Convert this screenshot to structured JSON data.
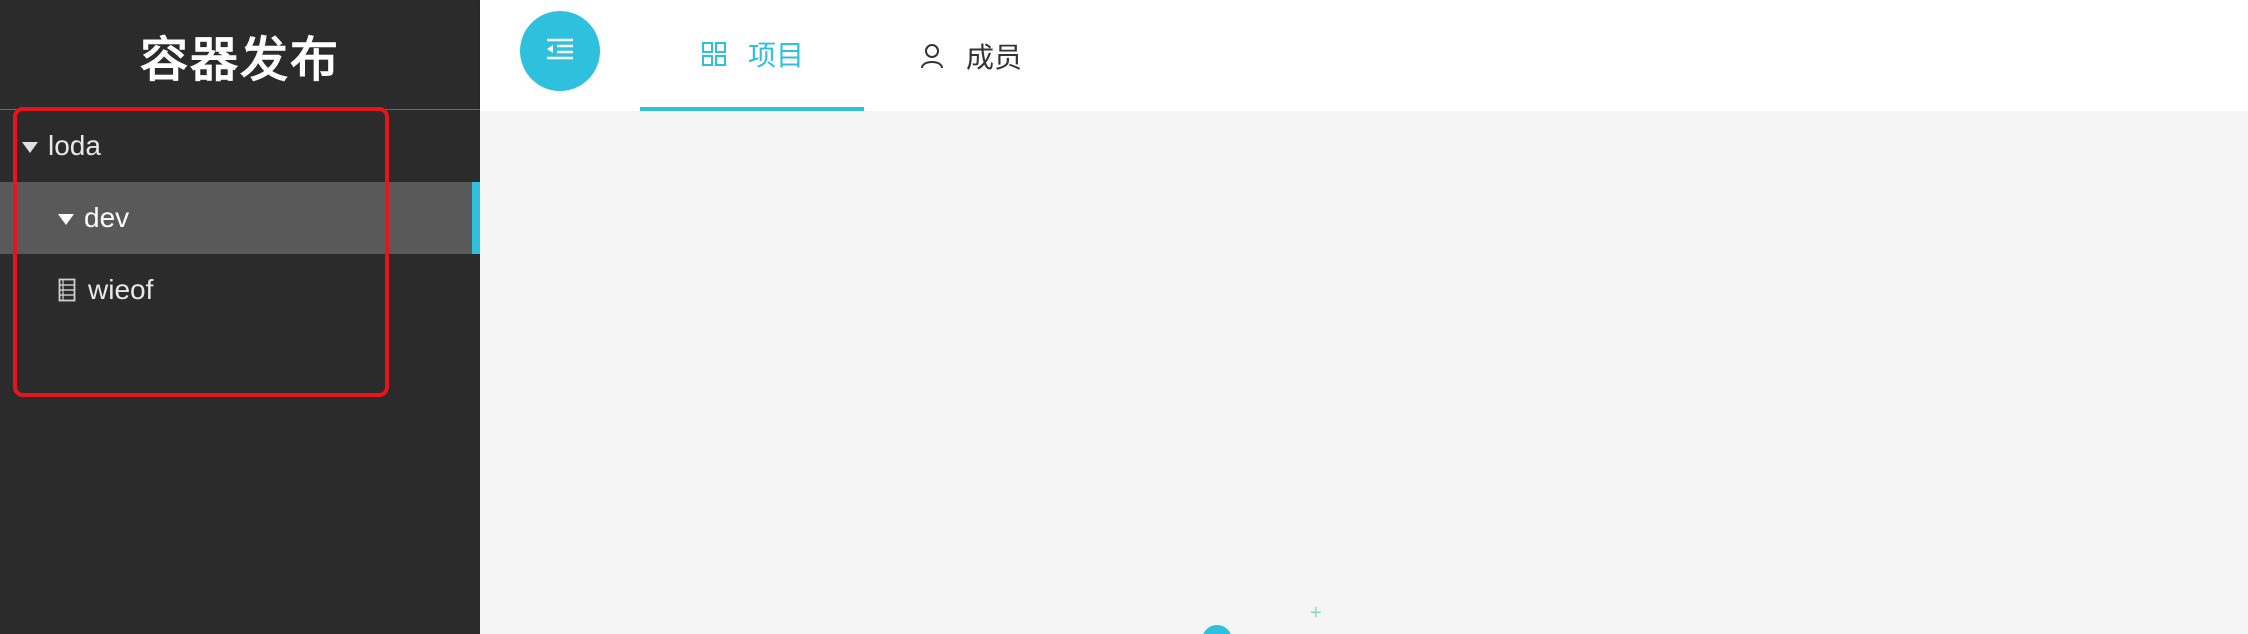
{
  "sidebar": {
    "title": "容器发布",
    "tree": [
      {
        "label": "loda",
        "icon": "caret-down-icon",
        "expanded": true
      },
      {
        "label": "dev",
        "icon": "caret-down-icon",
        "expanded": true,
        "selected": true
      },
      {
        "label": "wieof",
        "icon": "file-list-icon"
      }
    ]
  },
  "header": {
    "menu_toggle_icon": "menu-fold-icon",
    "tabs": [
      {
        "label": "项目",
        "icon": "grid-icon",
        "active": true
      },
      {
        "label": "成员",
        "icon": "user-icon",
        "active": false
      }
    ]
  },
  "colors": {
    "accent": "#2ec0dc",
    "sidebar_bg": "#2b2b2b",
    "selected_bg": "#595959",
    "highlight": "#e8141b"
  }
}
